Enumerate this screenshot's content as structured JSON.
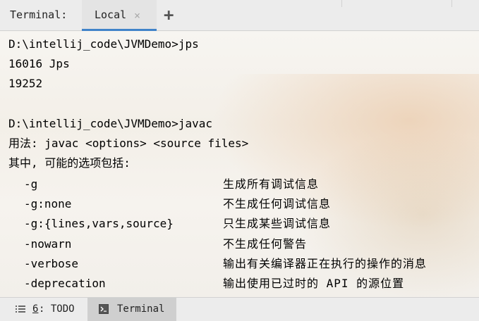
{
  "toolwindow": {
    "label": "Terminal:",
    "tab_label": "Local",
    "tab_close": "×",
    "add_button": "+"
  },
  "console": {
    "lines": [
      "D:\\intellij_code\\JVMDemo>jps",
      "16016 Jps",
      "19252",
      "",
      "D:\\intellij_code\\JVMDemo>javac",
      "用法: javac <options> <source files>",
      "其中, 可能的选项包括:"
    ],
    "options": [
      {
        "flag": "-g",
        "desc": "生成所有调试信息"
      },
      {
        "flag": "-g:none",
        "desc": "不生成任何调试信息"
      },
      {
        "flag": "-g:{lines,vars,source}",
        "desc": "只生成某些调试信息"
      },
      {
        "flag": "-nowarn",
        "desc": "不生成任何警告"
      },
      {
        "flag": "-verbose",
        "desc": "输出有关编译器正在执行的操作的消息"
      },
      {
        "flag": "-deprecation",
        "desc": "输出使用已过时的 API 的源位置"
      }
    ]
  },
  "statusbar": {
    "todo_number": "6",
    "todo_label": ": TODO",
    "terminal_label": "Terminal"
  }
}
